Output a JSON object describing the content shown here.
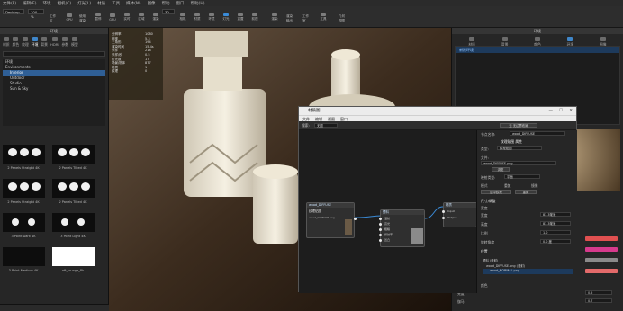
{
  "menubar": {
    "items": [
      "文件(F)",
      "编辑(E)",
      "环境",
      "相机(C)",
      "灯光(L)",
      "材质",
      "工具",
      "媒体(M)",
      "图像",
      "帮助",
      "窗口",
      "帮助(H)"
    ]
  },
  "toolbar": {
    "view_dropdown": "Desktop",
    "zoom_dropdown": "100 %",
    "num_dropdown": "30",
    "buttons": [
      "工作区",
      "CPU",
      "使用渲染",
      "暂停",
      "GPU",
      "实时",
      "区域",
      "渲染",
      "相机",
      "材质",
      "环境",
      "灯光",
      "重置",
      "前视",
      "渲染",
      "渲染输出",
      "工作室",
      "工具",
      "几何视图"
    ]
  },
  "left_panel": {
    "header": "环境",
    "tabs": [
      "材质",
      "颜色",
      "纹理",
      "环境",
      "背景",
      "HDRI",
      "参数",
      "模型"
    ],
    "tree": [
      {
        "label": "环境",
        "selected": false
      },
      {
        "label": "Environments",
        "selected": false
      },
      {
        "label": "Interior",
        "selected": true
      },
      {
        "label": "Outdoor",
        "selected": false
      },
      {
        "label": "Studio",
        "selected": false
      },
      {
        "label": "Sun & Sky",
        "selected": false
      }
    ],
    "thumbs": [
      {
        "label": "2 Panels Straight 4K"
      },
      {
        "label": "2 Panels Tilted 4K"
      },
      {
        "label": "2 Panels Straight 4K"
      },
      {
        "label": "2 Panels Tilted 4K"
      },
      {
        "label": "3 Point Dark 4K"
      },
      {
        "label": "3 Point Light 4K"
      },
      {
        "label": "3 Point Medium 4K"
      },
      {
        "label": "aft_lounge_8k"
      }
    ]
  },
  "viewport": {
    "stats": [
      "分辨率",
      "帧率",
      "三角形",
      "渲染时间",
      "采样",
      "采样/秒",
      "灯光数",
      "场景/物体",
      "材质",
      "纹理"
    ],
    "stat_vals": [
      "1080",
      "5.3",
      "194",
      "15.4s",
      "218",
      "0.5",
      "17",
      "877",
      "1",
      "0"
    ]
  },
  "right_panel": {
    "header": "环境",
    "tabs": [
      "材质",
      "背景",
      "颜色",
      "环境",
      "图像"
    ],
    "selected_env": "新建环境",
    "labels": [
      "亮度",
      "伽马"
    ],
    "values": [
      "0.5",
      "0.7"
    ],
    "swatch_colors": [
      "#e05050",
      "#d63a8c",
      "#8a8a8a",
      "#e36a6a"
    ]
  },
  "dialog": {
    "title": "材质图",
    "menu": [
      "文件",
      "编辑",
      "视图",
      "窗口"
    ],
    "search_label": "搜索:",
    "search_dropdown": "无图",
    "layout_button": "无 无边界布局",
    "node_texture_header": "wood_DIFFUSE",
    "node_texture_title": "纹理贴图",
    "node_texture_file": "wood_DIFFUSE.png",
    "node_mat_header": "塑料",
    "node_mat_ports": [
      "漫射",
      "高光",
      "粗糙",
      "折射率",
      "凹凸"
    ],
    "node_out_header": "材质",
    "node_out_ports": [
      "Input",
      "Output"
    ],
    "props_name_label": "节点名称:",
    "props_name_value": "wood_DIFFUSE",
    "props_header": "纹理贴图 属性",
    "props_type_label": "类型:",
    "props_type_value": "纹理贴图",
    "props_file_label": "文件:",
    "props_file_value": "wood_DIFFUSE.png",
    "props_open_label": "浏览",
    "props_mapping_label": "映射类型:",
    "props_mapping_value": "平面",
    "props_map_mode": "模式",
    "props_radio_a": "重复",
    "props_radio_b": "镜像",
    "props_btn_a": "居中纹理",
    "props_btn_b": "重置",
    "section_size": "尺寸/调整",
    "size_label": "宽度",
    "width_label": "宽度",
    "width_val": "83.3毫米",
    "height_label": "高度",
    "height_val": "83.3毫米",
    "ratio_label": "比例",
    "ratio_val": "1.0",
    "angle_label": "旋转角度",
    "angle_val": "0.0 度",
    "section_pos": "位置",
    "children": [
      "塑料 (漫射)",
      "wood_DIFFUSE.png (漫射)",
      "wood_NORMAL.png"
    ],
    "color_val": "颜色"
  }
}
